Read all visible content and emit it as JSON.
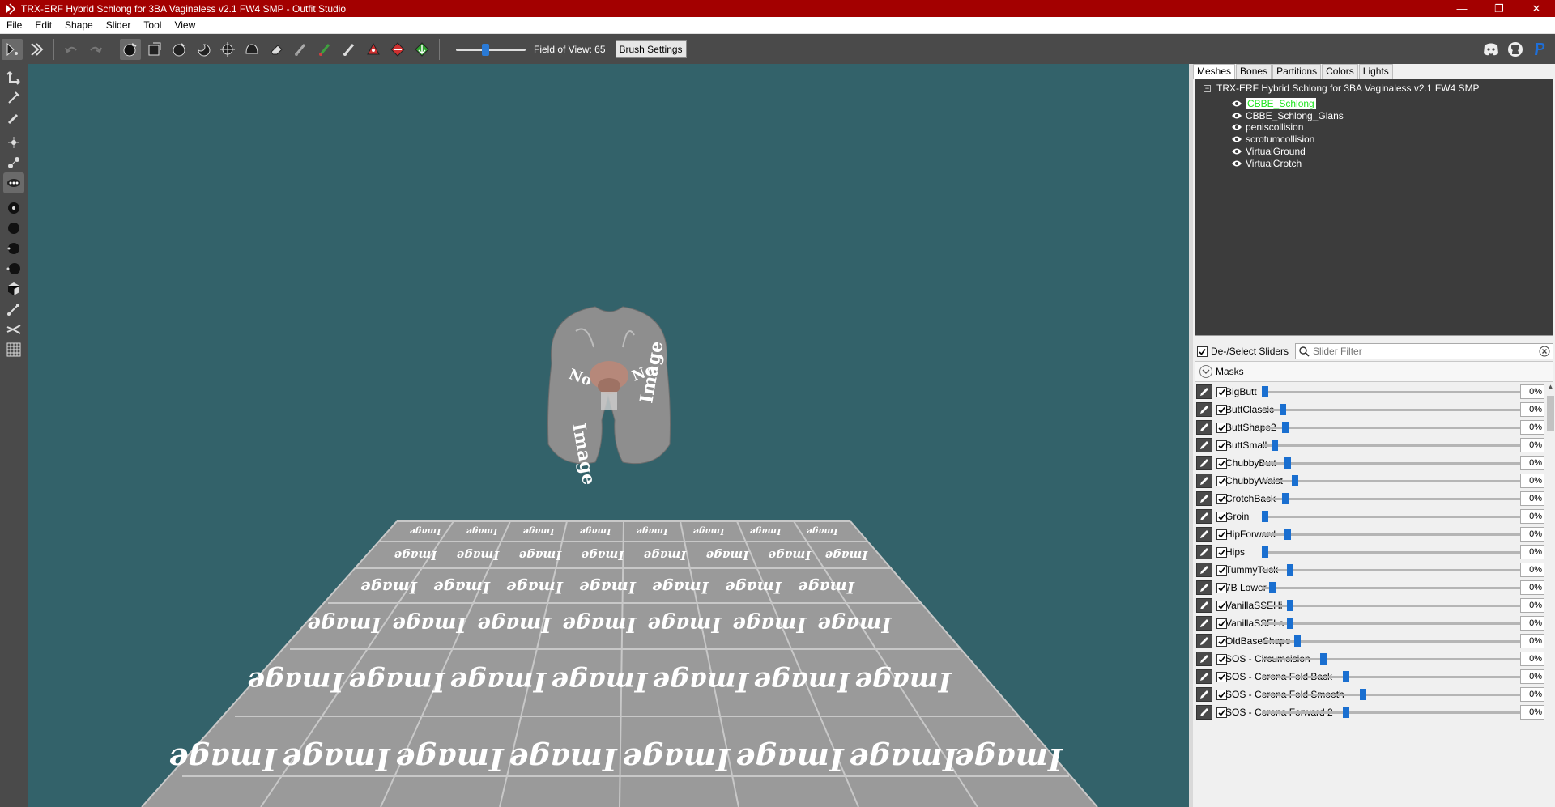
{
  "window": {
    "title": "TRX-ERF Hybrid Schlong for 3BA Vaginaless v2.1 FW4 SMP - Outfit Studio",
    "minimize": "—",
    "restore": "❐",
    "close": "✕"
  },
  "menu": [
    "File",
    "Edit",
    "Shape",
    "Slider",
    "Tool",
    "View"
  ],
  "toolbar": {
    "fov_label": "Field of View: 65",
    "fov_value": 65,
    "fov_fraction": 0.42,
    "brush_settings": "Brush Settings"
  },
  "icons": {
    "left_tools": [
      "select-icon",
      "transform-icon",
      "pivot-icon",
      "vertex-select-icon",
      "node-icon",
      "bone-icon",
      "pose-icon",
      "inflate-icon",
      "deflate-icon",
      "move-icon",
      "smooth-icon",
      "weight-icon",
      "mesh-icon",
      "grid-icon"
    ],
    "toolbar": [
      "pointer-icon",
      "select-icon",
      "undo-icon",
      "redo-icon",
      "mask-brush-icon",
      "unmask-icon",
      "inflate-brush-icon",
      "deflate-brush-icon",
      "move-brush-icon",
      "smooth-brush-icon",
      "eraser-icon",
      "paint-icon",
      "color-icon",
      "alpha-icon",
      "weight-icon",
      "cut-icon",
      "collapse-icon"
    ],
    "right": [
      "discord-icon",
      "github-icon",
      "paypal-icon"
    ]
  },
  "tabs": [
    "Meshes",
    "Bones",
    "Partitions",
    "Colors",
    "Lights"
  ],
  "active_tab": "Meshes",
  "tree": {
    "root": "TRX-ERF Hybrid Schlong for 3BA Vaginaless v2.1 FW4 SMP",
    "toggle": "−",
    "items": [
      {
        "label": "CBBE_Schlong",
        "selected": true
      },
      {
        "label": "CBBE_Schlong_Glans",
        "selected": false
      },
      {
        "label": "peniscollision",
        "selected": false
      },
      {
        "label": "scrotumcollision",
        "selected": false
      },
      {
        "label": "VirtualGround",
        "selected": false
      },
      {
        "label": "VirtualCrotch",
        "selected": false
      }
    ]
  },
  "slider_panel": {
    "deselect_label": "De-/Select Sliders",
    "filter_placeholder": "Slider Filter",
    "masks_label": "Masks"
  },
  "sliders": [
    {
      "name": "BigButt",
      "value": "0%",
      "pos": 0.0
    },
    {
      "name": "ButtClassic",
      "value": "0%",
      "pos": 0.07
    },
    {
      "name": "ButtShape2",
      "value": "0%",
      "pos": 0.08
    },
    {
      "name": "ButtSmall",
      "value": "0%",
      "pos": 0.04
    },
    {
      "name": "ChubbyButt",
      "value": "0%",
      "pos": 0.09
    },
    {
      "name": "ChubbyWaist",
      "value": "0%",
      "pos": 0.12
    },
    {
      "name": "CrotchBack",
      "value": "0%",
      "pos": 0.08
    },
    {
      "name": "Groin",
      "value": "0%",
      "pos": 0.0
    },
    {
      "name": "HipForward",
      "value": "0%",
      "pos": 0.09
    },
    {
      "name": "Hips",
      "value": "0%",
      "pos": 0.0
    },
    {
      "name": "TummyTuck",
      "value": "0%",
      "pos": 0.1
    },
    {
      "name": "7B Lower",
      "value": "0%",
      "pos": 0.03
    },
    {
      "name": "VanillaSSEHi",
      "value": "0%",
      "pos": 0.1
    },
    {
      "name": "VanillaSSELo",
      "value": "0%",
      "pos": 0.1
    },
    {
      "name": "OldBaseShape",
      "value": "0%",
      "pos": 0.13
    },
    {
      "name": "SOS - Circumcision",
      "value": "0%",
      "pos": 0.23
    },
    {
      "name": "SOS - Corona Fold Back",
      "value": "0%",
      "pos": 0.32
    },
    {
      "name": "SOS - Corona Fold Smooth",
      "value": "0%",
      "pos": 0.39
    },
    {
      "name": "SOS - Corona Forward 2",
      "value": "0%",
      "pos": 0.32
    }
  ],
  "floor_texture_text": [
    "No",
    "Image"
  ],
  "colors": {
    "titlebar": "#a30000",
    "viewport": "#33626a",
    "toolbar": "#4a4a4a",
    "selected_text": "#1de41d",
    "slider_thumb": "#1a6fd0"
  }
}
